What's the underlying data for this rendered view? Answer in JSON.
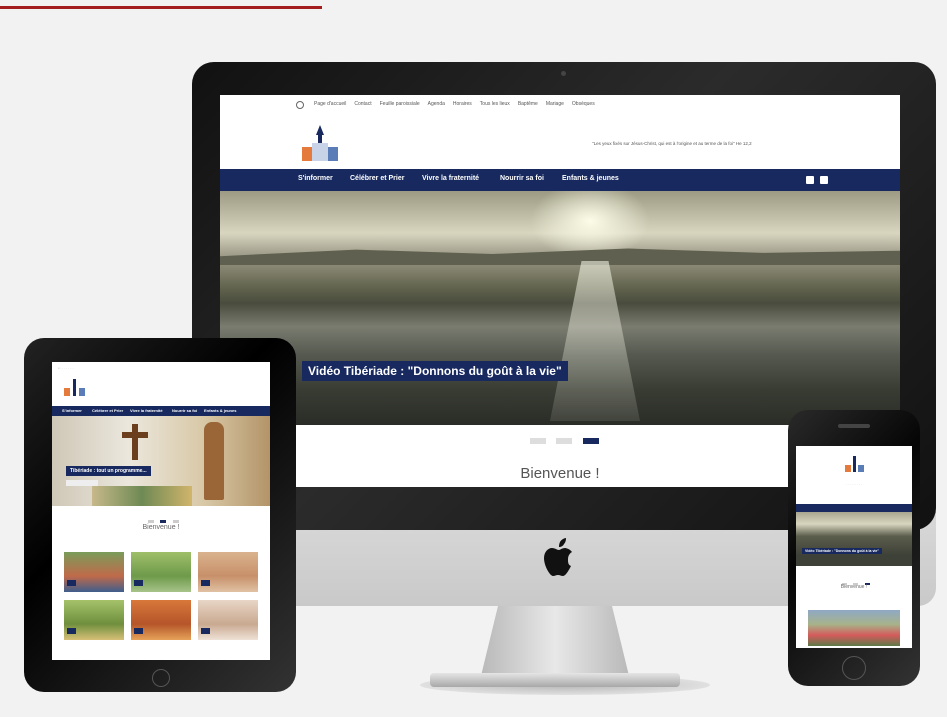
{
  "imac": {
    "top_nav": [
      "Page d'accueil",
      "Contact",
      "Feuille paroissiale",
      "Agenda",
      "Horaires",
      "Tous les lieux",
      "Baptême",
      "Mariage",
      "Obsèques"
    ],
    "tagline": "\"Les yeux fixés sur Jésus-Christ, qui est à l'origine et au terme de la foi\" He 12,2",
    "menu": [
      "S'informer",
      "Célébrer et Prier",
      "Vivre la fraternité",
      "Nourrir sa foi",
      "Enfants & jeunes"
    ],
    "hero_caption": "Vidéo Tibériade : \"Donnons du goût à la vie\"",
    "welcome": "Bienvenue !",
    "slides": 3,
    "active_slide": 3
  },
  "ipad": {
    "hero_caption": "Tibériade : tout un programme...",
    "welcome": "Bienvenue !",
    "slides": 3,
    "active_slide": 2
  },
  "iphone": {
    "hero_caption": "Vidéo Tibériade : \"Donnons du goût à la vie\"",
    "welcome": "Bienvenue !",
    "slides": 3,
    "active_slide": 3
  },
  "colors": {
    "brand_navy": "#17295f",
    "accent_red": "#a31f1f",
    "background": "#f2f2f2"
  }
}
